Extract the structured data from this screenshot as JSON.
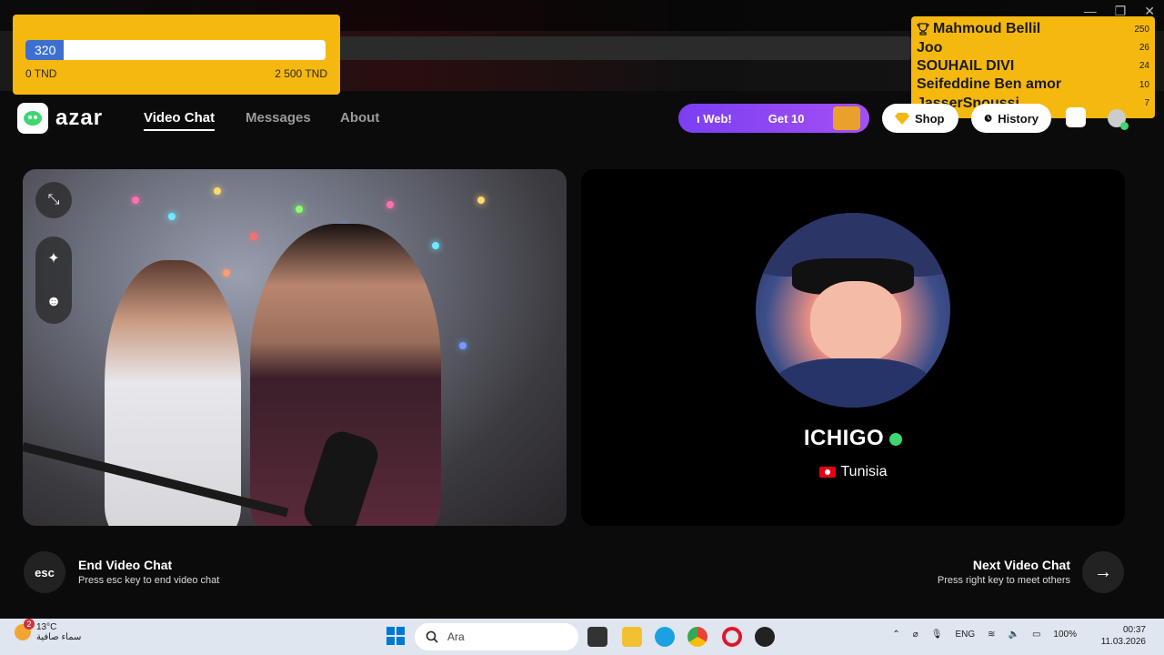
{
  "goal": {
    "current": "320",
    "min_label": "0 TND",
    "max_label": "2 500 TND",
    "progress_fraction": 0.128,
    "bar_color": "#3d6fd1",
    "bg_color": "#f5b80f"
  },
  "leaderboard": [
    {
      "name": "Mahmoud Bellil",
      "score": "250",
      "icon": "trophy-icon"
    },
    {
      "name": "Joo",
      "score": "26"
    },
    {
      "name": "SOUHAIL DIVI",
      "score": "24"
    },
    {
      "name": "Seifeddine Ben amor",
      "score": "10"
    },
    {
      "name": "JasserSnoussi",
      "score": "7"
    }
  ],
  "nav": {
    "brand": "azar",
    "links": [
      "Video Chat",
      "Messages",
      "About"
    ],
    "active": "Video Chat",
    "promo_left": "ı Web!",
    "promo_right": "Get 10",
    "shop": "Shop",
    "history": "History"
  },
  "partner": {
    "name": "ICHIGO",
    "country": "Tunisia"
  },
  "controls": {
    "esc_key": "esc",
    "end_title": "End Video Chat",
    "end_sub": "Press esc key to end video chat",
    "next_title": "Next Video Chat",
    "next_sub": "Press right key to meet others"
  },
  "taskbar": {
    "weather_temp": "13°C",
    "weather_desc": "سماء صافية",
    "weather_badge": "2",
    "search_placeholder": "Ara",
    "language": "ENG",
    "battery": "100%",
    "time": "00:37",
    "date": "11.03.2026"
  },
  "colors": {
    "accent_purple": "#7b3ff2",
    "verified_green": "#3fd671",
    "overlay_yellow": "#f5b80f"
  }
}
